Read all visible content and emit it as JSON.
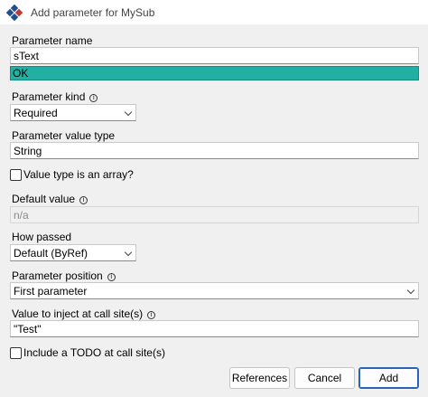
{
  "window": {
    "title": "Add parameter for MySub",
    "icon": "vba-diamond-icon"
  },
  "form": {
    "parameter_name": {
      "label": "Parameter name",
      "value": "sText"
    },
    "validation": {
      "text": "OK",
      "color": "#21b0a3"
    },
    "parameter_kind": {
      "label": "Parameter kind",
      "info": "ⓘ",
      "value": "Required"
    },
    "parameter_value_type": {
      "label": "Parameter value type",
      "value": "String"
    },
    "is_array": {
      "label": "Value type is an array?",
      "checked": false
    },
    "default_value": {
      "label": "Default value",
      "info": "ⓘ",
      "value": "n/a"
    },
    "how_passed": {
      "label": "How passed",
      "value": "Default (ByRef)"
    },
    "parameter_position": {
      "label": "Parameter position",
      "info": "ⓘ",
      "value": "First parameter"
    },
    "value_to_inject": {
      "label": "Value to inject at call site(s)",
      "info": "ⓘ",
      "value": "\"Test\""
    },
    "include_todo": {
      "label": "Include a TODO at call site(s)",
      "checked": false
    }
  },
  "buttons": {
    "references": "References",
    "cancel": "Cancel",
    "add": "Add"
  },
  "colors": {
    "accent_border": "#2a63b8",
    "ok_green": "#21b0a3"
  }
}
